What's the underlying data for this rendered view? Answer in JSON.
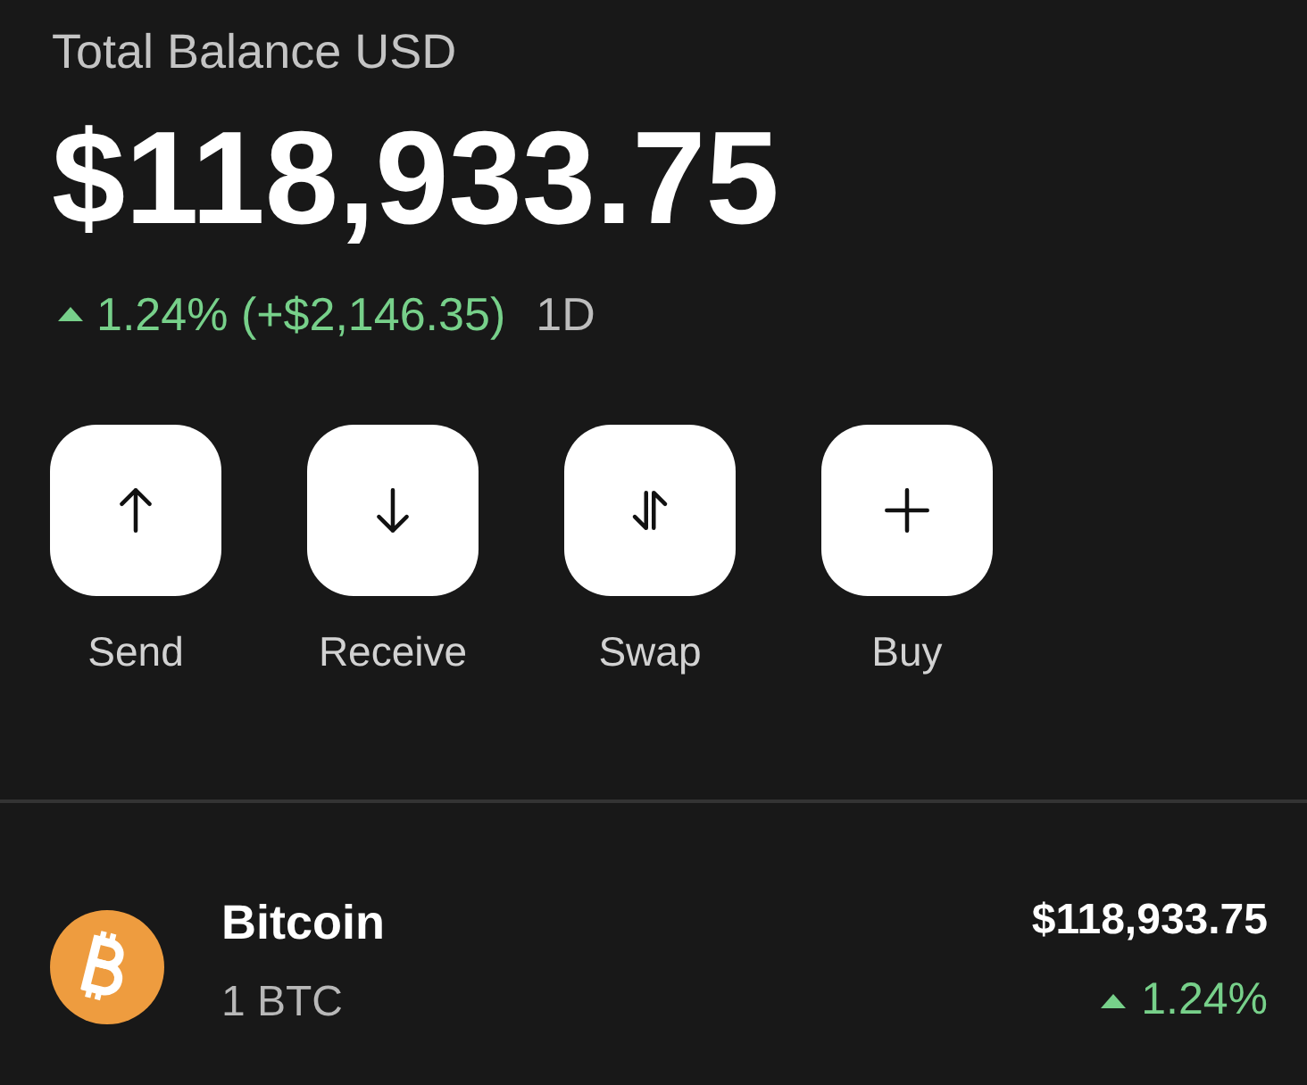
{
  "balance": {
    "label": "Total Balance USD",
    "amount": "$118,933.75",
    "change": {
      "rising": true,
      "text": "1.24% (+$2,146.35)",
      "period": "1D"
    }
  },
  "actions": [
    {
      "kind": "send",
      "label": "Send"
    },
    {
      "kind": "receive",
      "label": "Receive"
    },
    {
      "kind": "swap",
      "label": "Swap"
    },
    {
      "kind": "buy",
      "label": "Buy"
    }
  ],
  "assets": [
    {
      "kind": "bitcoin",
      "name": "Bitcoin",
      "quantity": "1 BTC",
      "value": "$118,933.75",
      "change": {
        "rising": true,
        "text": "1.24%"
      }
    }
  ]
}
